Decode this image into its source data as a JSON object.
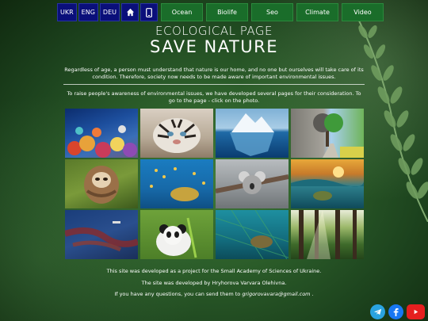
{
  "nav": {
    "languages": [
      "UKR",
      "ENG",
      "DEU"
    ],
    "tabs": [
      "Ocean",
      "Biolife",
      "Seo",
      "Climate",
      "Video"
    ],
    "home_icon": "home-icon",
    "mobile_icon": "mobile-icon"
  },
  "header": {
    "title_line1": "ECOLOGICAL PAGE",
    "title_line2": "SAVE NATURE"
  },
  "intro": "Regardless of age, a person must understand that nature is our home, and no one but ourselves will take care of its condition. Therefore, society now needs to be made aware of important environmental issues.",
  "cta": "To raise people's awareness of environmental issues, we have developed several pages for their consideration. To go to the page - click on the photo.",
  "gallery": [
    "coral-reef",
    "tiger",
    "iceberg",
    "tree-split-landscape",
    "sloth",
    "sea-turtle-fish",
    "koala",
    "ocean-sunset-waves",
    "oil-spill",
    "panda",
    "turtle-net",
    "forest-sunlight"
  ],
  "footer": {
    "line1": "This site was developed as a project for the Small Academy of Sciences of Ukraine.",
    "line2": "The site was developed by Hryhorova Varvara Olehivna.",
    "line3_prefix": "If you have any questions, you can send them to",
    "email": "grigorovavara@gmail.com",
    "line3_suffix": "."
  },
  "socials": [
    "telegram-icon",
    "facebook-icon",
    "youtube-icon"
  ],
  "colors": {
    "lang_btn": "#0a0f7a",
    "tab_btn": "#1a6d2a",
    "telegram": "#2aa3e0",
    "facebook": "#1877f2",
    "youtube": "#e61f1f"
  }
}
